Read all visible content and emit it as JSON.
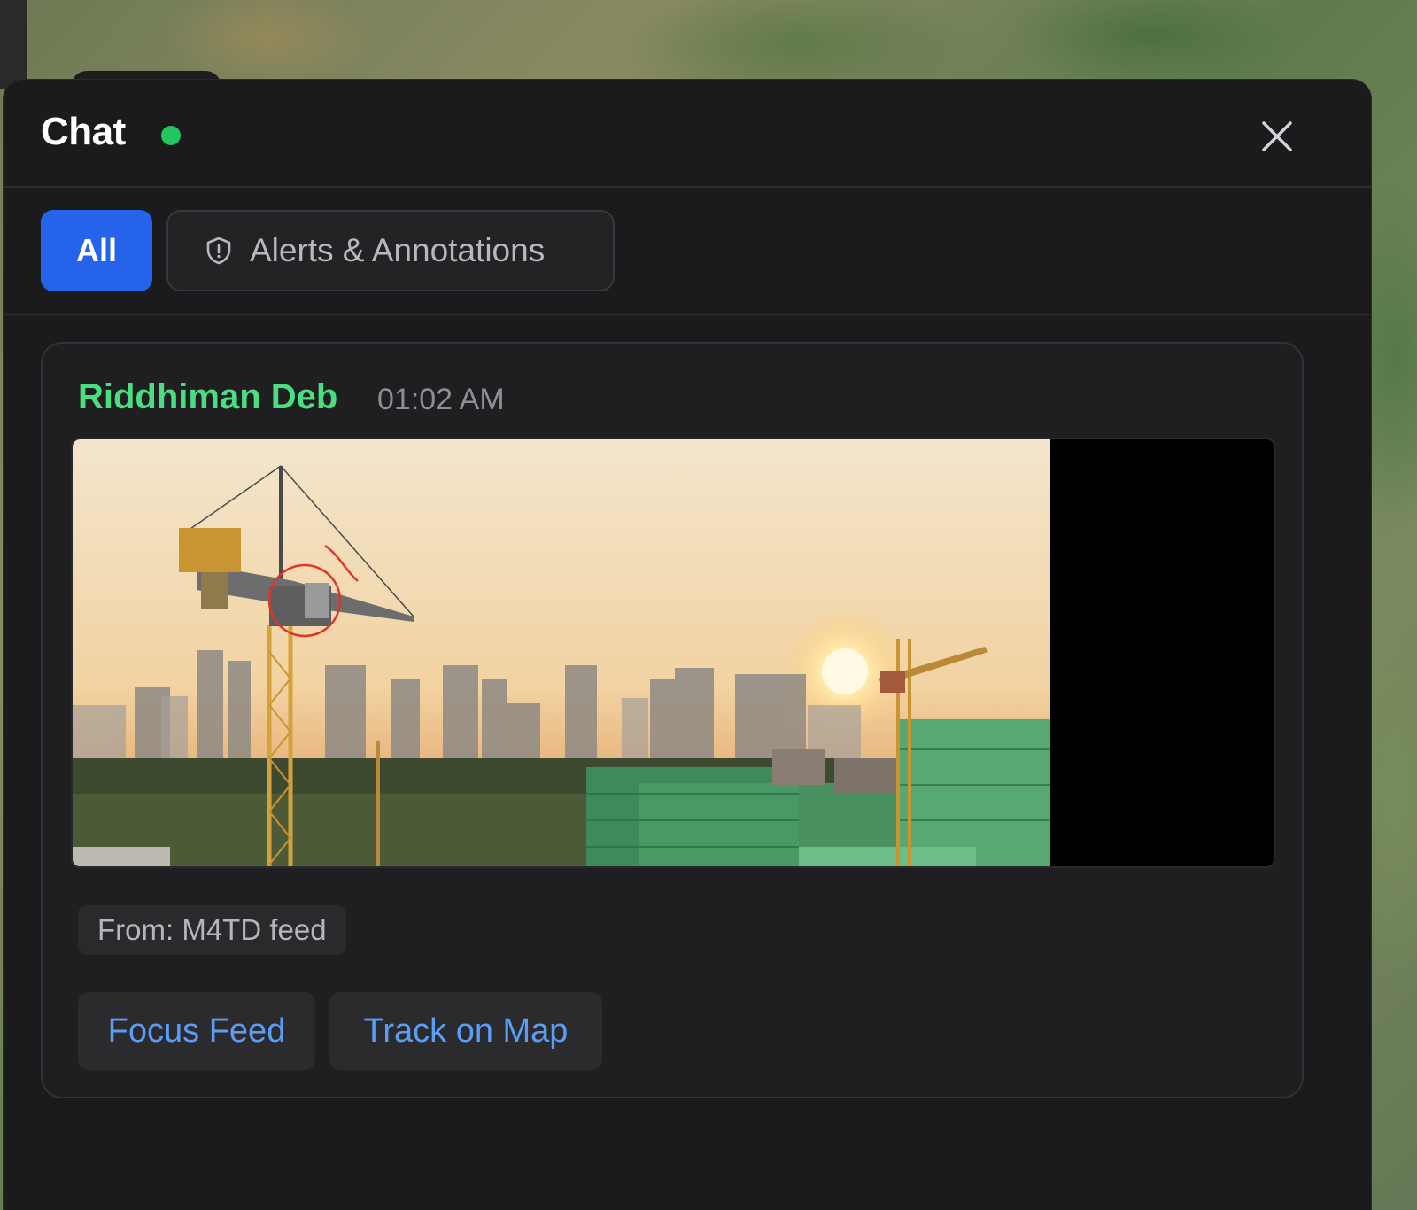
{
  "header": {
    "title": "Chat",
    "status": "online",
    "status_color": "#22c55e",
    "close_icon": "close-icon"
  },
  "filters": {
    "all_label": "All",
    "alerts_label": "Alerts & Annotations",
    "alerts_icon": "shield-icon",
    "active": "All",
    "active_color": "#2563eb"
  },
  "message": {
    "sender": "Riddhiman Deb",
    "sender_color": "#4ade80",
    "time": "01:02 AM",
    "media": {
      "description_icon": "construction-site-image",
      "annotation": "red-circle-on-crane-cab"
    },
    "source": "From: M4TD feed",
    "actions": {
      "focus_label": "Focus Feed",
      "track_label": "Track on Map",
      "link_color": "#5b9df5"
    }
  }
}
